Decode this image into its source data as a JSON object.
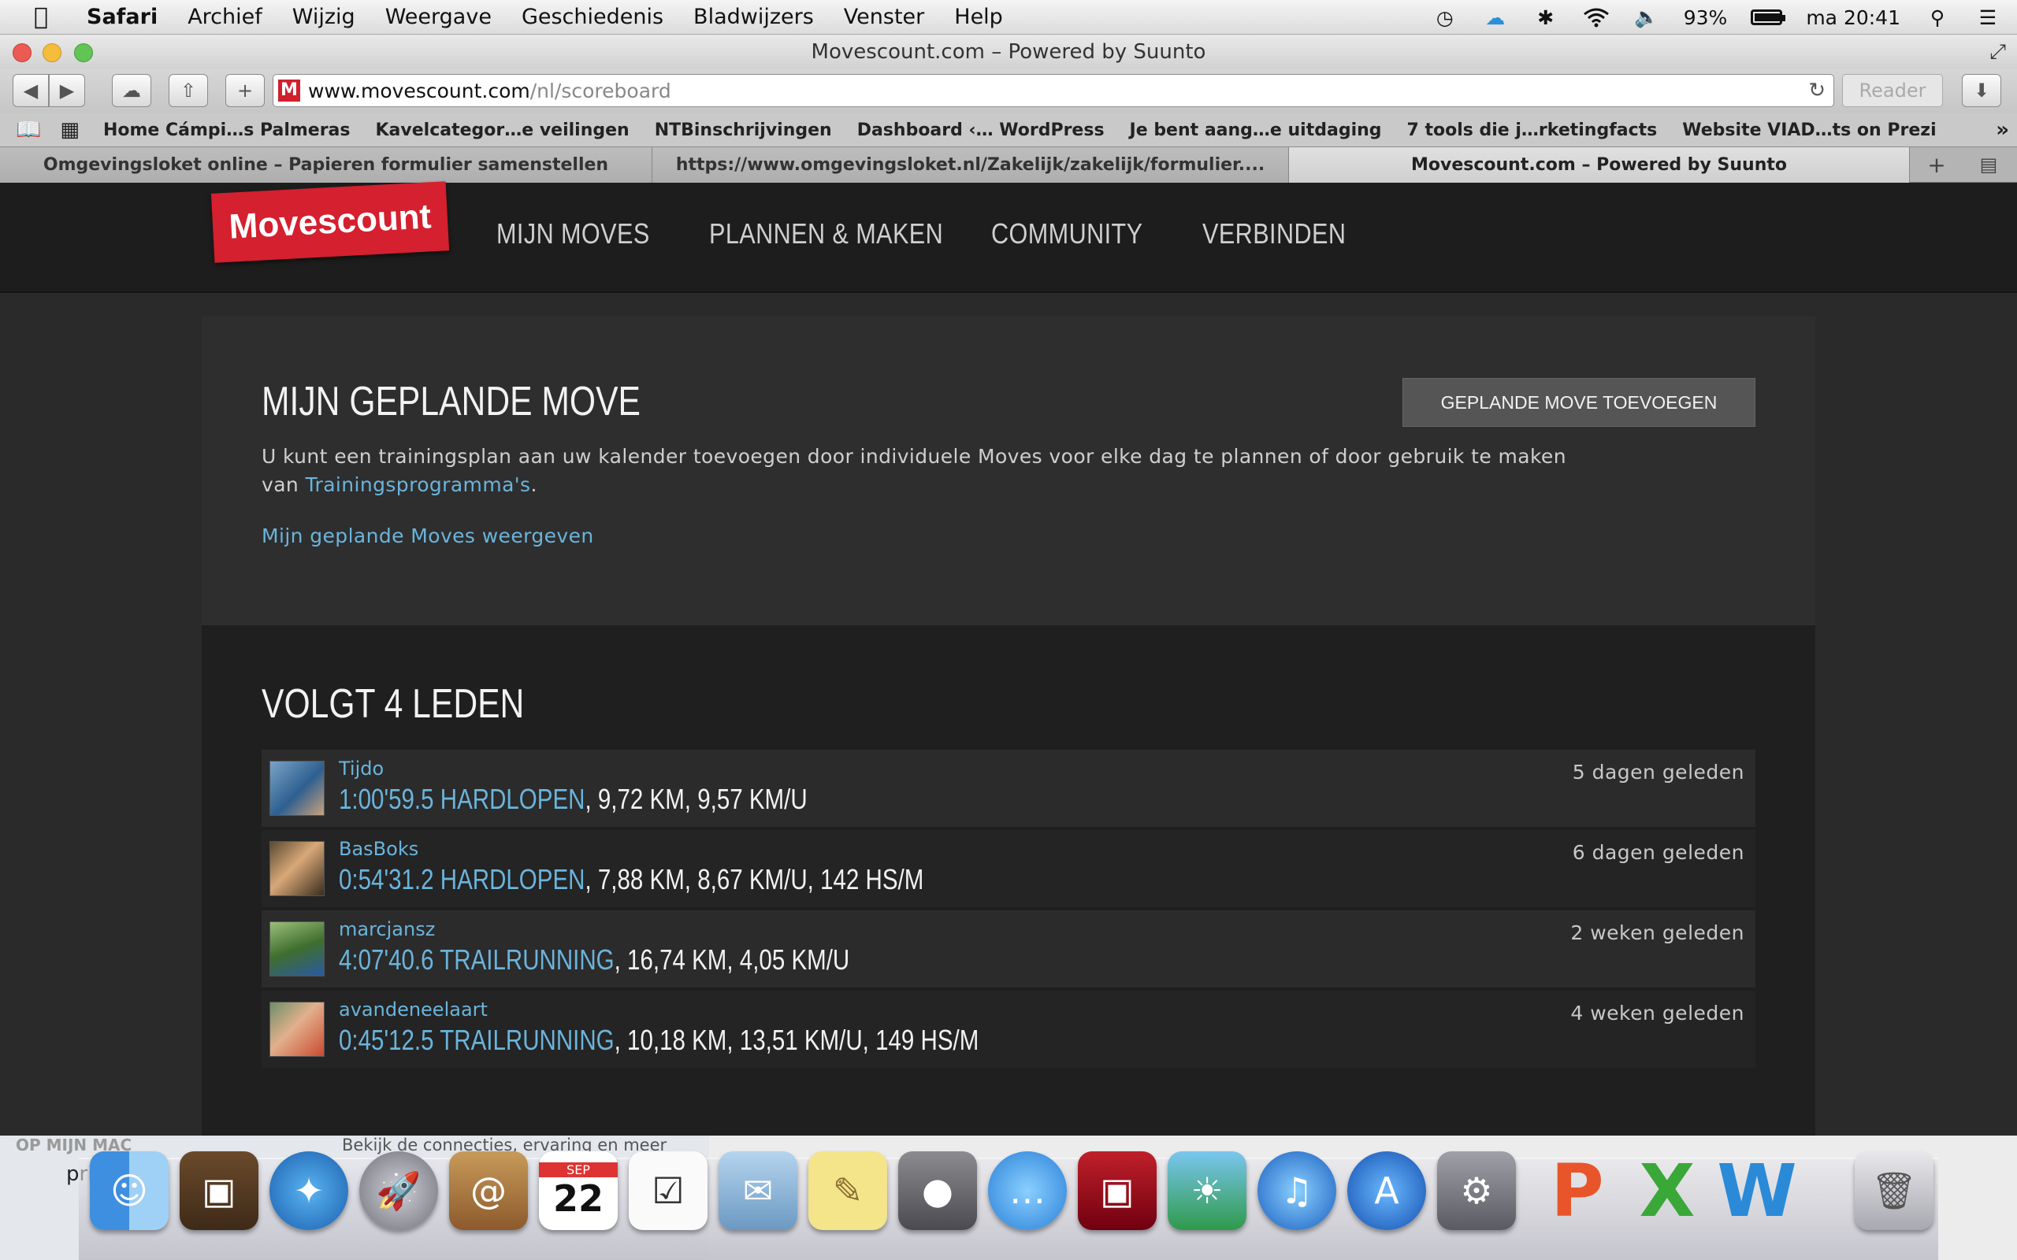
{
  "menubar": {
    "app": "Safari",
    "items": [
      "Archief",
      "Wijzig",
      "Weergave",
      "Geschiedenis",
      "Bladwijzers",
      "Venster",
      "Help"
    ],
    "battery_percent": "93%",
    "battery_level": 0.93,
    "clock": "ma 20:41"
  },
  "window": {
    "title": "Movescount.com – Powered by Suunto"
  },
  "toolbar": {
    "url_host": "www.movescount.com",
    "url_path": "/nl/scoreboard",
    "reader_label": "Reader",
    "favicon_letter": "M"
  },
  "bookmarks": [
    "Home Cámpi…s Palmeras",
    "Kavelcategor…e veilingen",
    "NTBinschrijvingen",
    "Dashboard ‹… WordPress",
    "Je bent aang…e uitdaging",
    "7 tools die j…rketingfacts",
    "Website VIAD…ts on Prezi"
  ],
  "tabs": [
    "Omgevingsloket online – Papieren formulier samenstellen",
    "https://www.omgevingsloket.nl/Zakelijk/zakelijk/formulier....",
    "Movescount.com – Powered by Suunto"
  ],
  "site": {
    "logo": "Movescount",
    "nav": [
      "MIJN MOVES",
      "PLANNEN & MAKEN",
      "COMMUNITY",
      "VERBINDEN"
    ]
  },
  "planned": {
    "title": "MIJN GEPLANDE MOVE",
    "add_button": "GEPLANDE MOVE TOEVOEGEN",
    "intro": "U kunt een trainingsplan aan uw kalender toevoegen door individuele Moves voor elke dag te plannen of door gebruik te maken van",
    "intro_link": "Trainingsprogramma's",
    "intro_end": ".",
    "show_link": "Mijn geplande Moves weergeven"
  },
  "following": {
    "title": "VOLGT 4 LEDEN",
    "rows": [
      {
        "user": "Tijdo",
        "move": "1:00'59.5 HARDLOPEN",
        "stats": ", 9,72 KM, 9,57 KM/U",
        "when": "5 dagen geleden"
      },
      {
        "user": "BasBoks",
        "move": "0:54'31.2 HARDLOPEN",
        "stats": ", 7,88 KM, 8,67 KM/U, 142 HS/M",
        "when": "6 dagen geleden"
      },
      {
        "user": "marcjansz",
        "move": "4:07'40.6 TRAILRUNNING",
        "stats": ", 16,74 KM, 4,05 KM/U",
        "when": "2 weken geleden"
      },
      {
        "user": "avandeneelaart",
        "move": "0:45'12.5 TRAILRUNNING",
        "stats": ", 10,18 KM, 13,51 KM/U, 149 HS/M",
        "when": "4 weken geleden"
      }
    ]
  },
  "desktop_behind": {
    "sidebar_heading": "OP MIJN MAC",
    "sidebar_item": "pri",
    "snippet": "Bekijk de connecties, ervaring en meer"
  },
  "dock": {
    "calendar_month": "SEP",
    "calendar_day": "22",
    "icons": [
      "finder-icon",
      "iphoto-icon",
      "safari-icon",
      "launchpad-icon",
      "contacts-icon",
      "calendar-icon",
      "reminders-icon",
      "mail-icon",
      "notes-icon",
      "facetime-icon",
      "messages-icon",
      "photobooth-icon",
      "preview-icon",
      "itunes-icon",
      "appstore-icon",
      "system-preferences-icon",
      "powerpoint-icon",
      "excel-icon",
      "word-icon",
      "trash-icon"
    ]
  }
}
